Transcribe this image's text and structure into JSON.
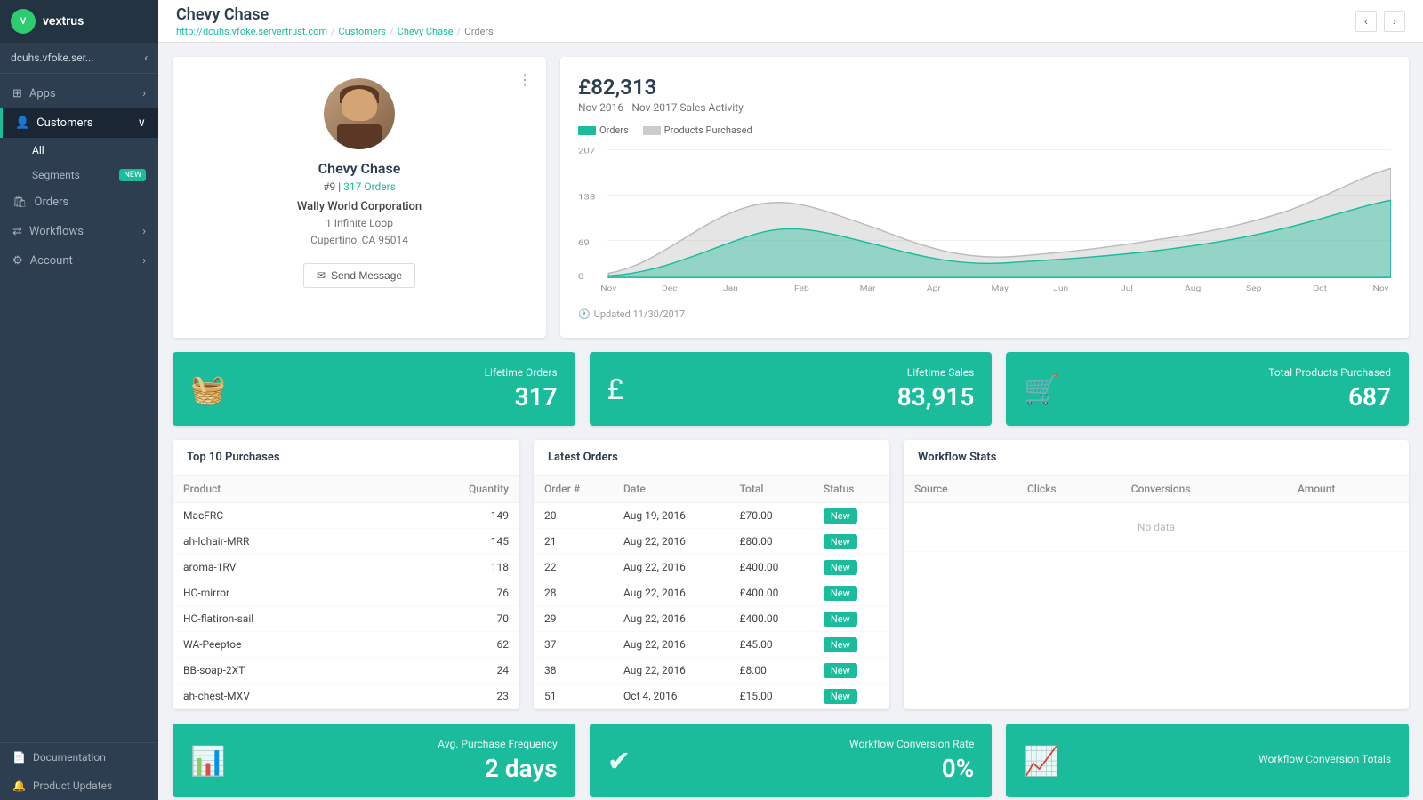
{
  "app": {
    "logo_text": "vextrus",
    "org_name": "dcuhs.vfoke.ser..."
  },
  "sidebar": {
    "items": [
      {
        "id": "apps",
        "label": "Apps",
        "icon": "grid-icon"
      },
      {
        "id": "customers",
        "label": "Customers",
        "icon": "users-icon",
        "active": true,
        "expanded": true
      },
      {
        "id": "orders",
        "label": "Orders",
        "icon": "shopping-bag-icon"
      },
      {
        "id": "workflows",
        "label": "Workflows",
        "icon": "flow-icon"
      },
      {
        "id": "account",
        "label": "Account",
        "icon": "settings-icon"
      }
    ],
    "customers_sub": [
      {
        "id": "all",
        "label": "All",
        "active": true
      },
      {
        "id": "segments",
        "label": "Segments",
        "badge": "NEW"
      }
    ],
    "bottom": [
      {
        "id": "documentation",
        "label": "Documentation",
        "icon": "book-icon"
      },
      {
        "id": "product-updates",
        "label": "Product Updates",
        "icon": "bell-icon"
      }
    ]
  },
  "header": {
    "title": "Chevy Chase",
    "url": "http://dcuhs.vfoke.servertrust.com",
    "breadcrumb": [
      {
        "label": "Customers",
        "href": true
      },
      {
        "label": "Chevy Chase",
        "href": true
      },
      {
        "label": "Orders",
        "href": false
      }
    ]
  },
  "profile": {
    "name": "Chevy Chase",
    "id": "#9",
    "orders_count": "317 Orders",
    "company": "Wally World Corporation",
    "address_line1": "1 Infinite Loop",
    "address_line2": "Cupertino, CA 95014",
    "send_message_label": "Send Message"
  },
  "chart": {
    "amount": "£82,313",
    "subtitle": "Nov 2016 - Nov 2017 Sales Activity",
    "legend": [
      {
        "label": "Orders",
        "color": "#1abc9c"
      },
      {
        "label": "Products Purchased",
        "color": "#ccc"
      }
    ],
    "y_labels": [
      "207",
      "138",
      "69",
      "0"
    ],
    "x_labels": [
      "Nov",
      "Dec",
      "Jan",
      "Feb",
      "Mar",
      "Apr",
      "May",
      "Jun",
      "Jul",
      "Aug",
      "Sep",
      "Oct",
      "Nov"
    ],
    "updated": "Updated 11/30/2017"
  },
  "stats": [
    {
      "id": "lifetime-orders",
      "label": "Lifetime Orders",
      "value": "317",
      "icon": "basket-icon"
    },
    {
      "id": "lifetime-sales",
      "label": "Lifetime Sales",
      "value": "83,915",
      "icon": "pound-icon"
    },
    {
      "id": "total-products",
      "label": "Total Products Purchased",
      "value": "687",
      "icon": "cart-icon"
    }
  ],
  "top_purchases": {
    "title": "Top 10 Purchases",
    "columns": [
      "Product",
      "Quantity"
    ],
    "rows": [
      {
        "product": "MacFRC",
        "qty": "149"
      },
      {
        "product": "ah-lchair-MRR",
        "qty": "145"
      },
      {
        "product": "aroma-1RV",
        "qty": "118"
      },
      {
        "product": "HC-mirror",
        "qty": "76"
      },
      {
        "product": "HC-flatiron-sail",
        "qty": "70"
      },
      {
        "product": "WA-Peeptoe",
        "qty": "62"
      },
      {
        "product": "BB-soap-2XT",
        "qty": "24"
      },
      {
        "product": "ah-chest-MXV",
        "qty": "23"
      }
    ]
  },
  "latest_orders": {
    "title": "Latest Orders",
    "columns": [
      "Order #",
      "Date",
      "Total",
      "Status"
    ],
    "rows": [
      {
        "order": "20",
        "date": "Aug 19, 2016",
        "total": "£70.00",
        "status": "New"
      },
      {
        "order": "21",
        "date": "Aug 22, 2016",
        "total": "£80.00",
        "status": "New"
      },
      {
        "order": "22",
        "date": "Aug 22, 2016",
        "total": "£400.00",
        "status": "New"
      },
      {
        "order": "28",
        "date": "Aug 22, 2016",
        "total": "£400.00",
        "status": "New"
      },
      {
        "order": "29",
        "date": "Aug 22, 2016",
        "total": "£400.00",
        "status": "New"
      },
      {
        "order": "37",
        "date": "Aug 22, 2016",
        "total": "£45.00",
        "status": "New"
      },
      {
        "order": "38",
        "date": "Aug 22, 2016",
        "total": "£8.00",
        "status": "New"
      },
      {
        "order": "51",
        "date": "Oct 4, 2016",
        "total": "£15.00",
        "status": "New"
      }
    ]
  },
  "workflow_stats": {
    "title": "Workflow Stats",
    "columns": [
      "Source",
      "Clicks",
      "Conversions",
      "Amount"
    ],
    "rows": []
  },
  "bottom_stats": [
    {
      "id": "avg-purchase",
      "label": "Avg. Purchase Frequency",
      "value": "2 days",
      "icon": "bar-chart-icon"
    },
    {
      "id": "workflow-conversion",
      "label": "Workflow Conversion Rate",
      "value": "0%",
      "icon": "check-icon"
    },
    {
      "id": "workflow-totals",
      "label": "Workflow Conversion Totals",
      "value": "",
      "icon": "trend-icon"
    }
  ]
}
